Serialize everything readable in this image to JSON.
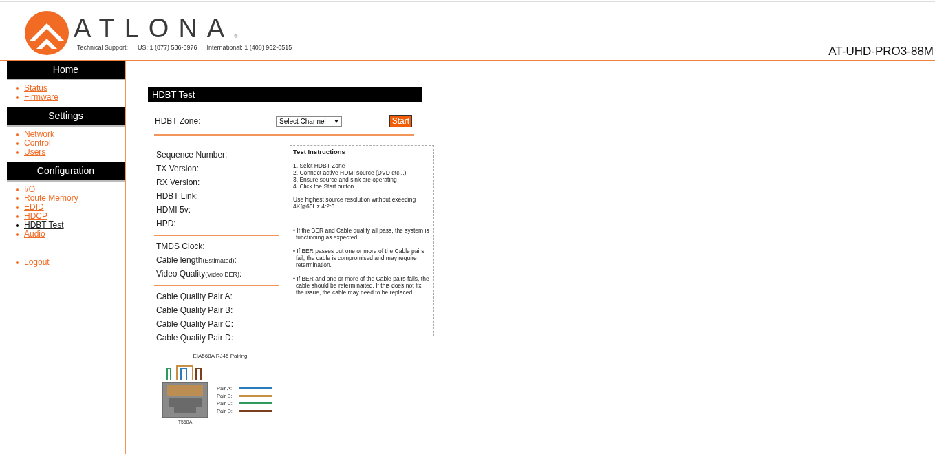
{
  "header": {
    "logo_text": "ATLONA",
    "logo_mark": "®",
    "support_label": "Technical Support:",
    "support_us": "US: 1 (877) 536-3976",
    "support_intl": "International: 1 (408) 962-0515",
    "model": "AT-UHD-PRO3-88M"
  },
  "sidebar": {
    "sections": [
      {
        "title": "Home",
        "items": [
          {
            "label": "Status",
            "selected": false
          },
          {
            "label": "Firmware",
            "selected": false
          }
        ]
      },
      {
        "title": "Settings",
        "items": [
          {
            "label": "Network",
            "selected": false
          },
          {
            "label": "Control",
            "selected": false
          },
          {
            "label": "Users",
            "selected": false
          }
        ]
      },
      {
        "title": "Configuration",
        "items": [
          {
            "label": "I/O",
            "selected": false
          },
          {
            "label": "Route Memory",
            "selected": false
          },
          {
            "label": "EDID",
            "selected": false
          },
          {
            "label": "HDCP",
            "selected": false
          },
          {
            "label": "HDBT Test",
            "selected": true
          },
          {
            "label": "Audio",
            "selected": false
          }
        ]
      }
    ],
    "logout": "Logout"
  },
  "panel": {
    "title": "HDBT Test",
    "zone_label": "HDBT Zone:",
    "zone_select": "Select Channel",
    "start_button": "Start",
    "field_groups": [
      [
        {
          "label": "Sequence Number:"
        },
        {
          "label": "TX Version:"
        },
        {
          "label": "RX Version:"
        },
        {
          "label": "HDBT Link:"
        },
        {
          "label": "HDMI 5v:"
        },
        {
          "label": "HPD:"
        }
      ],
      [
        {
          "label": "TMDS Clock:"
        },
        {
          "label": "Cable length",
          "note": "(Estimated)",
          "suffix": ":"
        },
        {
          "label": "Video Quality",
          "note": "(Video BER)",
          "suffix": ":"
        }
      ],
      [
        {
          "label": "Cable Quality Pair A:"
        },
        {
          "label": "Cable Quality Pair B:"
        },
        {
          "label": "Cable Quality Pair C:"
        },
        {
          "label": "Cable Quality Pair D:"
        }
      ]
    ],
    "instructions": {
      "title": "Test Instructions",
      "steps": [
        "1. Selct HDBT Zone",
        "2. Connect active HDMI source (DVD etc...)",
        "3. Ensure source and sink are operating",
        "4. Click the Start button"
      ],
      "note": "Use highest source resolution without exeeding 4K@60Hz 4:2:0",
      "bullets": [
        "• If the BER and Cable quality all pass, the system is functioning as expected.",
        "• If BER passes but one or more of the Cable pairs fail, the cable is compromised and may require retermination.",
        "• If BER and one or more of the Cable pairs fails, the cable should be reterminaited. If this does not fix the issue, the cable may need to be replaced."
      ]
    },
    "pairing": {
      "title": "EIA568A RJ45 Pairing",
      "caption": "T568A",
      "pairs": [
        {
          "label": "Pair A:",
          "color": "#2b7bbd"
        },
        {
          "label": "Pair B:",
          "color": "#c98f45"
        },
        {
          "label": "Pair C:",
          "color": "#2f9a5e"
        },
        {
          "label": "Pair D:",
          "color": "#7b3f1c"
        }
      ]
    }
  }
}
